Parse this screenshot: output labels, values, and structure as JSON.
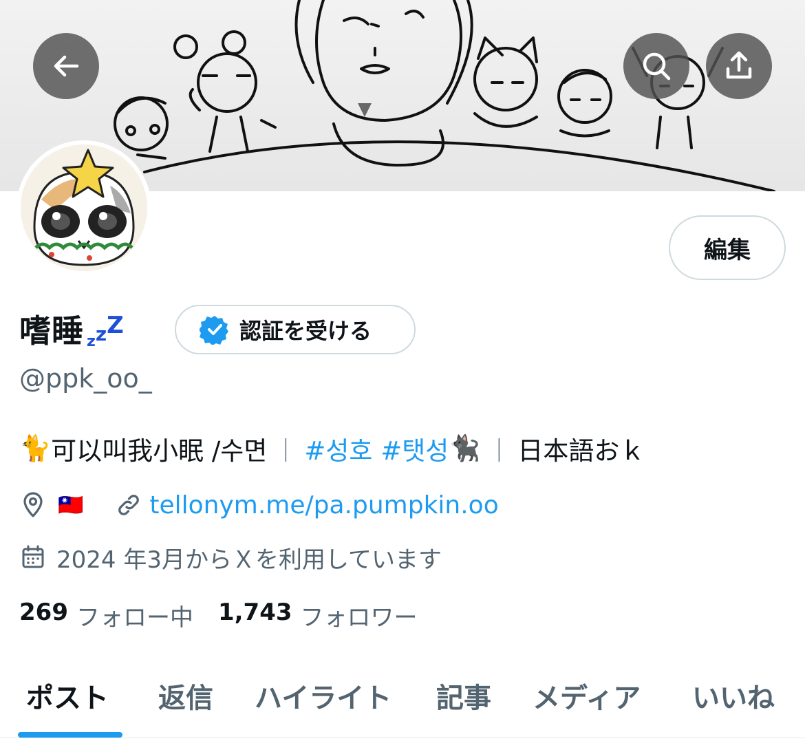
{
  "header": {
    "back_label": "back",
    "search_label": "search",
    "share_label": "share"
  },
  "profile": {
    "display_name": "嗜睡",
    "name_suffix": [
      "z",
      "z",
      "Z"
    ],
    "verify_button": "認証を受ける",
    "edit_button": "編集",
    "handle": "@ppk_oo_",
    "bio": {
      "cat_emoji": "🐈",
      "text": "可以叫我小眠 /수면",
      "separator": "｜",
      "hashtag1": "#성호",
      "hashtag2": "#탯성",
      "black_cat_emoji": "🐈‍⬛",
      "separator2": "｜",
      "text2": "日本語おｋ"
    },
    "location_flag": "🇹🇼",
    "website": "tellonym.me/pa.pumpkin.oo",
    "joined": "2024 年3月からＸを利用しています",
    "following_count": "269",
    "following_label": "フォロー中",
    "followers_count": "1,743",
    "followers_label": "フォロワー"
  },
  "tabs": [
    {
      "label": "ポスト",
      "active": true
    },
    {
      "label": "返信",
      "active": false
    },
    {
      "label": "ハイライト",
      "active": false
    },
    {
      "label": "記事",
      "active": false
    },
    {
      "label": "メディア",
      "active": false
    },
    {
      "label": "いいね",
      "active": false
    }
  ],
  "colors": {
    "accent": "#1d9bf0",
    "secondary_text": "#536471",
    "primary_text": "#0f1419",
    "verified_badge": "#1d9bf0"
  },
  "icons": {
    "back": "arrow-left-icon",
    "search": "search-icon",
    "share": "share-icon",
    "verified": "verified-badge-icon",
    "location": "location-pin-icon",
    "link": "link-icon",
    "calendar": "calendar-icon"
  }
}
